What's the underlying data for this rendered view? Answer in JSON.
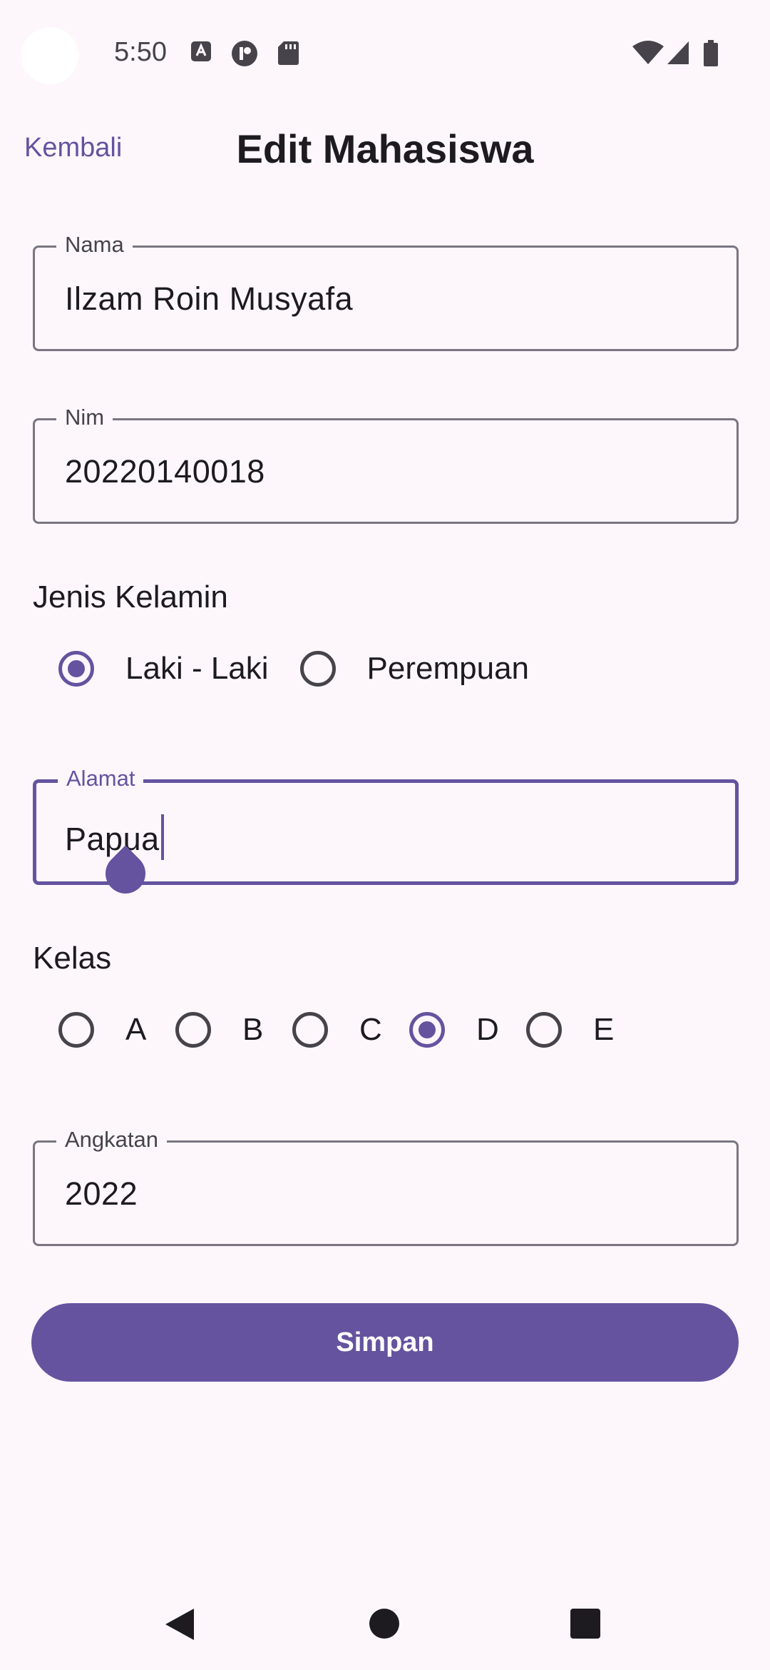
{
  "status_bar": {
    "time": "5:50",
    "left_icons": [
      "a-notification-icon",
      "sync-icon",
      "sd-card-icon"
    ],
    "right_icons": [
      "wifi-icon",
      "signal-icon",
      "battery-icon"
    ]
  },
  "top_bar": {
    "back_label": "Kembali",
    "title": "Edit Mahasiswa"
  },
  "form": {
    "nama": {
      "label": "Nama",
      "value": "Ilzam Roin Musyafa"
    },
    "nim": {
      "label": "Nim",
      "value": "20220140018"
    },
    "jenis_kelamin": {
      "label": "Jenis Kelamin",
      "options": [
        "Laki - Laki",
        "Perempuan"
      ],
      "selected": "Laki - Laki"
    },
    "alamat": {
      "label": "Alamat",
      "value": "Papua"
    },
    "kelas": {
      "label": "Kelas",
      "options": [
        "A",
        "B",
        "C",
        "D",
        "E"
      ],
      "selected": "D"
    },
    "angkatan": {
      "label": "Angkatan",
      "value": "2022"
    }
  },
  "save_label": "Simpan",
  "colors": {
    "accent": "#65539f",
    "background": "#fdf7fc",
    "outline": "#7a7580",
    "text": "#1d1b20"
  }
}
